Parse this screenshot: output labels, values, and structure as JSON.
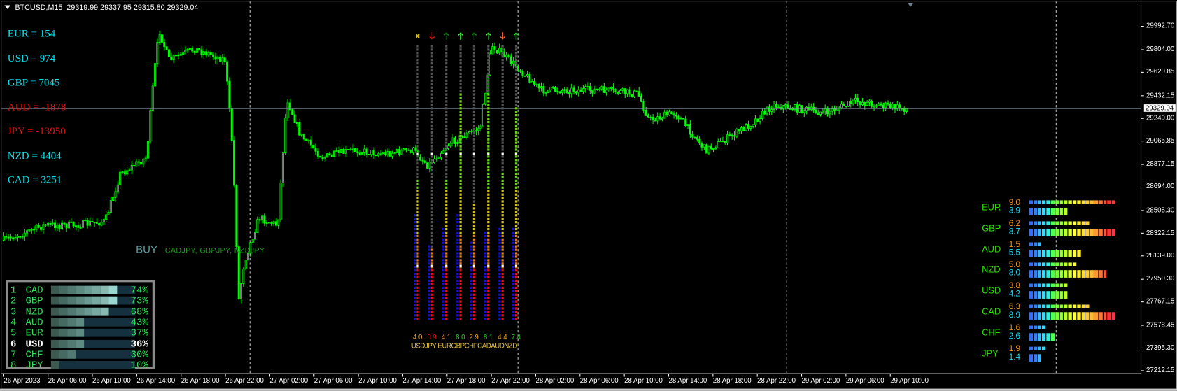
{
  "header": {
    "symbol": "BTCUSD,M15",
    "open": "29319.99",
    "high": "29337.95",
    "low": "29315.80",
    "close": "29329.04"
  },
  "currency_totals": [
    {
      "label": "EUR = 154",
      "color": "#00e5ee"
    },
    {
      "label": "USD = 974",
      "color": "#00e5ee"
    },
    {
      "label": "GBP = 7045",
      "color": "#00e5ee"
    },
    {
      "label": "AUD = -1878",
      "color": "#e01010"
    },
    {
      "label": "JPY = -13950",
      "color": "#e01010"
    },
    {
      "label": "NZD = 4404",
      "color": "#00e5ee"
    },
    {
      "label": "CAD = 3251",
      "color": "#00e5ee"
    }
  ],
  "signal": {
    "label": "BUY",
    "pairs": "CADJPY,  GBPJPY,  NZDJPY"
  },
  "ranking": [
    {
      "rank": "1",
      "currency": "CAD",
      "percent": "74%",
      "value": 74
    },
    {
      "rank": "2",
      "currency": "GBP",
      "percent": "73%",
      "value": 73
    },
    {
      "rank": "3",
      "currency": "NZD",
      "percent": "68%",
      "value": 68
    },
    {
      "rank": "4",
      "currency": "AUD",
      "percent": "43%",
      "value": 43
    },
    {
      "rank": "5",
      "currency": "EUR",
      "percent": "37%",
      "value": 37
    },
    {
      "rank": "6",
      "currency": "USD",
      "percent": "36%",
      "value": 36,
      "highlight": true
    },
    {
      "rank": "7",
      "currency": "CHF",
      "percent": "30%",
      "value": 30
    },
    {
      "rank": "8",
      "currency": "JPY",
      "percent": "10%",
      "value": 10
    }
  ],
  "meter": {
    "labels": "USDJPY EURGBPCHFCADAUDNZD",
    "columns": [
      {
        "currency": "USD",
        "value": "4.0",
        "strength": 4.0,
        "color": "#f0a020",
        "arrow": "cross-icon",
        "arrow_color": "#e8c000"
      },
      {
        "currency": "JPY",
        "value": "0.9",
        "strength": 0.9,
        "color": "#e01010",
        "arrow": "arrow-down-icon",
        "arrow_color": "#ff1010"
      },
      {
        "currency": "EUR",
        "value": "4.1",
        "strength": 4.1,
        "color": "#f0a020",
        "arrow": "arrow-up-icon",
        "arrow_color": "#108a10"
      },
      {
        "currency": "GBP",
        "value": "8.0",
        "strength": 8.0,
        "color": "#20d020",
        "arrow": "arrow-up-icon",
        "arrow_color": "#30ff30"
      },
      {
        "currency": "CHF",
        "value": "2.9",
        "strength": 2.9,
        "color": "#f0a020",
        "arrow": "arrow-up-icon",
        "arrow_color": "#108a10"
      },
      {
        "currency": "CAD",
        "value": "8.1",
        "strength": 8.1,
        "color": "#20d020",
        "arrow": "arrow-up-icon",
        "arrow_color": "#30ff30"
      },
      {
        "currency": "AUD",
        "value": "4.4",
        "strength": 4.4,
        "color": "#f0a020",
        "arrow": "arrow-down-icon",
        "arrow_color": "#ff7030"
      },
      {
        "currency": "NZD",
        "value": "7.4",
        "strength": 7.4,
        "color": "#20d020",
        "arrow": "arrow-up-icon",
        "arrow_color": "#30ff30"
      }
    ]
  },
  "strength_panel": [
    {
      "currency": "EUR",
      "top": "9.0",
      "bottom": "3.9",
      "top_v": 9.0,
      "bottom_v": 3.9
    },
    {
      "currency": "GBP",
      "top": "6.2",
      "bottom": "8.7",
      "top_v": 6.2,
      "bottom_v": 8.7
    },
    {
      "currency": "AUD",
      "top": "1.5",
      "bottom": "5.5",
      "top_v": 1.5,
      "bottom_v": 5.5
    },
    {
      "currency": "NZD",
      "top": "5.0",
      "bottom": "8.0",
      "top_v": 5.0,
      "bottom_v": 8.0
    },
    {
      "currency": "USD",
      "top": "3.8",
      "bottom": "4.2",
      "top_v": 3.8,
      "bottom_v": 4.2
    },
    {
      "currency": "CAD",
      "top": "6.3",
      "bottom": "8.9",
      "top_v": 6.3,
      "bottom_v": 8.9
    },
    {
      "currency": "CHF",
      "top": "1.6",
      "bottom": "2.6",
      "top_v": 1.6,
      "bottom_v": 2.6
    },
    {
      "currency": "JPY",
      "top": "1.9",
      "bottom": "1.4",
      "top_v": 1.9,
      "bottom_v": 1.4
    }
  ],
  "price_axis": [
    "29992.70",
    "29804.00",
    "29620.85",
    "29432.15",
    "29249.00",
    "29065.85",
    "28877.15",
    "28694.00",
    "28505.30",
    "28322.15",
    "28139.00",
    "27950.30",
    "27767.15",
    "27578.45",
    "27395.30",
    "27212.15"
  ],
  "current_price": "29329.04",
  "time_axis": [
    "26 Apr 2023",
    "26 Apr 06:00",
    "26 Apr 10:00",
    "26 Apr 14:00",
    "26 Apr 18:00",
    "26 Apr 22:00",
    "27 Apr 02:00",
    "27 Apr 06:00",
    "27 Apr 10:00",
    "27 Apr 14:00",
    "27 Apr 18:00",
    "27 Apr 22:00",
    "28 Apr 02:00",
    "28 Apr 06:00",
    "28 Apr 10:00",
    "28 Apr 14:00",
    "28 Apr 18:00",
    "28 Apr 22:00",
    "29 Apr 02:00",
    "29 Apr 06:00",
    "29 Apr 10:00"
  ],
  "colors": {
    "candle": "#00ff00",
    "grid_line": "#c0c0c0",
    "price_line": "#8090a0"
  }
}
